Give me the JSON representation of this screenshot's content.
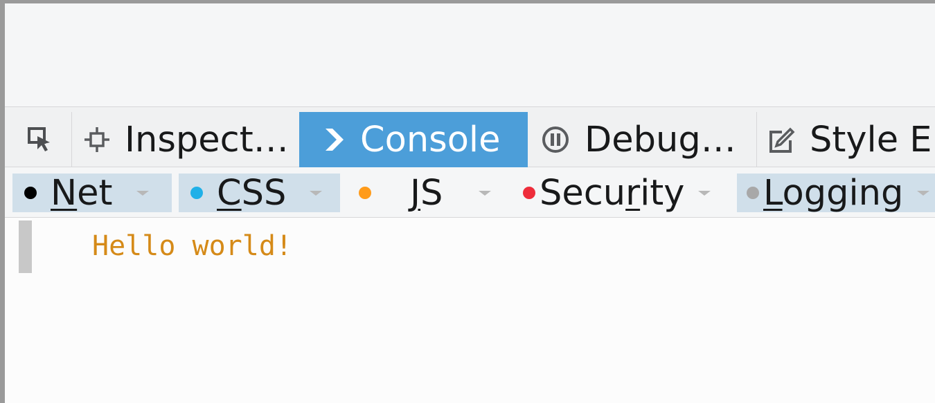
{
  "toolbar": {
    "tabs": [
      {
        "label": "",
        "icon": "element-picker-icon"
      },
      {
        "label": "Inspect…",
        "icon": "inspector-icon"
      },
      {
        "label": "Console",
        "icon": "console-chevron-icon",
        "selected": true
      },
      {
        "label": "Debug…",
        "icon": "debugger-pause-icon"
      },
      {
        "label": "Style E",
        "icon": "style-editor-pencil-icon"
      }
    ],
    "selected_color": "#4c9ed9"
  },
  "filters": [
    {
      "label": "Net",
      "accesskey_index": 0,
      "dot_color": "#000000",
      "active": true
    },
    {
      "label": "CSS",
      "accesskey_index": 0,
      "dot_color": "#1fb0e8",
      "active": true
    },
    {
      "label": "JS",
      "accesskey_index": 0,
      "dot_color": "#ff9b1a",
      "active": false
    },
    {
      "label": "Security",
      "accesskey_index": 4,
      "dot_color": "#ee2d3b",
      "active": false
    },
    {
      "label": "Logging",
      "accesskey_index": 0,
      "dot_color": "#a8a8a8",
      "active": true
    }
  ],
  "console": {
    "messages": [
      {
        "text": "Hello world!",
        "color": "#d58a18"
      }
    ]
  }
}
